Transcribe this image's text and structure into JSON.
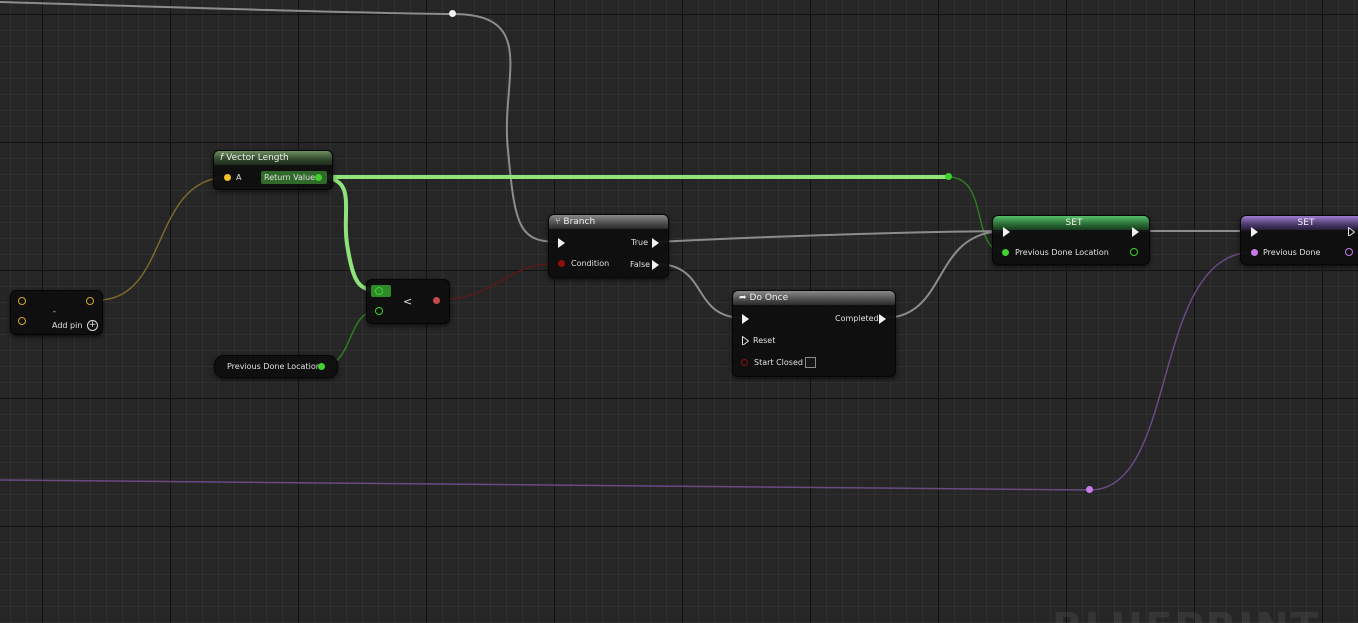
{
  "graph": {
    "watermark": "BLUEPRINT"
  },
  "nodes": {
    "make_array": {
      "title": "-",
      "add_pin_label": "Add pin",
      "add_pin_icon": "plus-circle-icon"
    },
    "vector_length": {
      "title": "Vector Length",
      "icon": "function-icon",
      "input_label": "A",
      "output_label": "Return Value"
    },
    "less_than": {
      "operator": "<"
    },
    "prev_location_getter": {
      "label": "Previous Done Location"
    },
    "branch": {
      "title": "Branch",
      "icon": "branch-icon",
      "condition_label": "Condition",
      "true_label": "True",
      "false_label": "False"
    },
    "do_once": {
      "title": "Do Once",
      "icon": "do-once-icon",
      "completed_label": "Completed",
      "reset_label": "Reset",
      "start_closed_label": "Start Closed"
    },
    "set_location": {
      "title": "SET",
      "var_label": "Previous Done Location"
    },
    "set_done": {
      "title": "SET",
      "var_label": "Previous Done"
    }
  },
  "colors": {
    "vector_pin": "#f3c12c",
    "float_pin": "#3fd12e",
    "bool_pin": "#8f0f0f",
    "exec_pin": "#f2f2f2",
    "purple_pin": "#c87bea",
    "wire_exec": "#9a9a9a",
    "wire_float_highlight": "#8fe37a",
    "wire_vector": "#7a6a2a",
    "wire_bool": "#5a1a1a",
    "wire_purple": "#6b4a82"
  }
}
